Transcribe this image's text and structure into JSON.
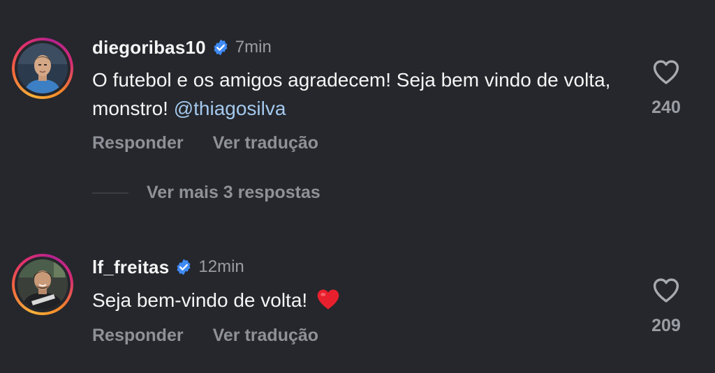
{
  "colors": {
    "background": "#25272c",
    "text_primary": "#f5f5f5",
    "text_secondary": "#8e9197",
    "mention": "#a4c9ee",
    "verified_badge": "#3f8af5"
  },
  "comments": [
    {
      "username": "diegoribas10",
      "verified": true,
      "time": "7min",
      "text_before": "O futebol e os amigos agradecem! Seja bem vindo de volta, monstro! ",
      "mention": "@thiagosilva",
      "like_count": "240",
      "reply_label": "Responder",
      "translate_label": "Ver tradução",
      "avatar_icon": "profile-photo",
      "like_icon": "heart-outline-icon"
    },
    {
      "username": "lf_freitas",
      "verified": true,
      "time": "12min",
      "text_before": "Seja bem-vindo de volta! ",
      "emoji": "red-heart-emoji",
      "like_count": "209",
      "reply_label": "Responder",
      "translate_label": "Ver tradução",
      "avatar_icon": "profile-photo",
      "like_icon": "heart-outline-icon"
    }
  ],
  "view_replies": {
    "label": "Ver mais 3 respostas"
  }
}
